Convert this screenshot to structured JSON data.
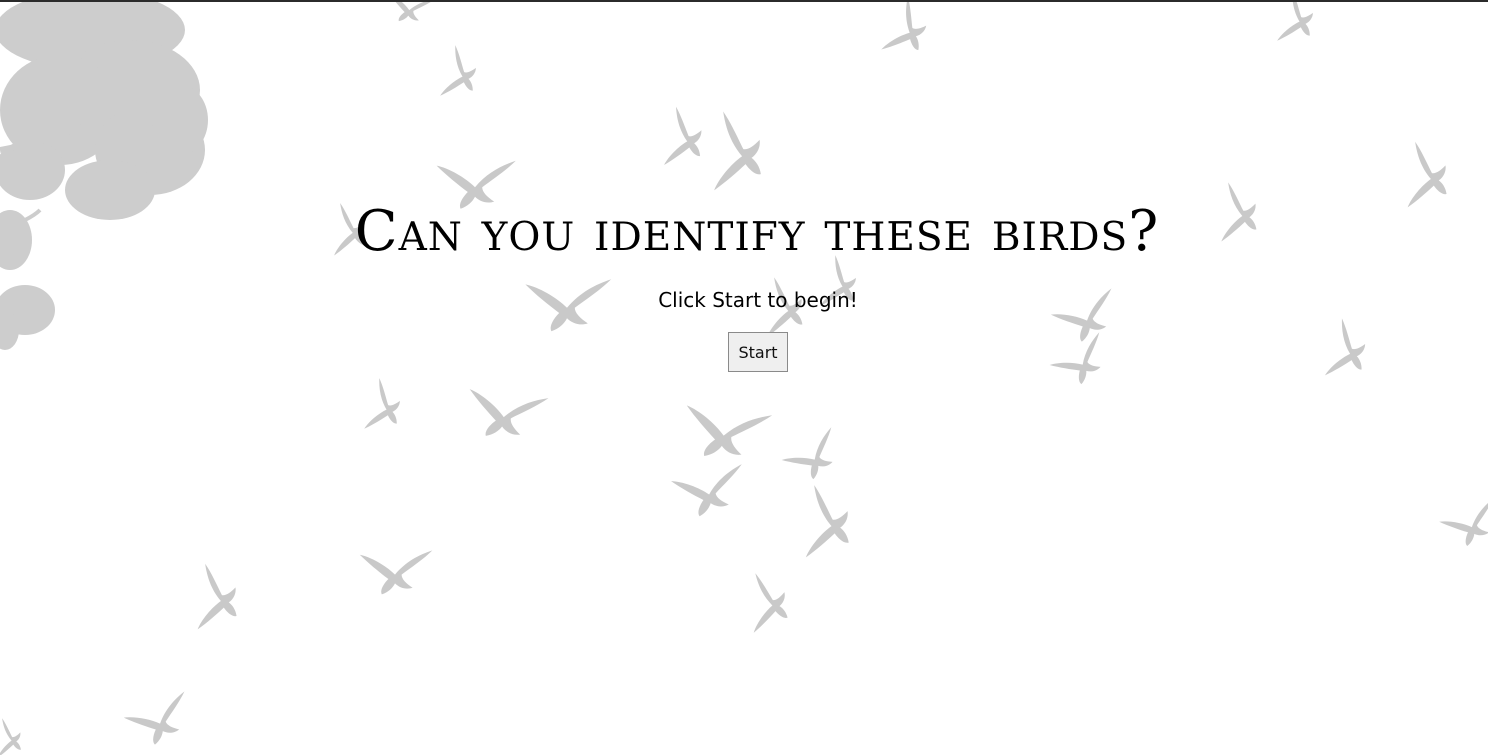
{
  "heading": "Can you identify these birds?",
  "instruction": "Click Start to begin!",
  "start_button": "Start",
  "colors": {
    "background": "#ffffff",
    "bird_silhouette": "#c9c9c9",
    "tree_silhouette": "#cdcdcd",
    "text": "#000000",
    "button_bg": "#efefef"
  },
  "background_icons": [
    "tree-branch-icon",
    "flying-bird-icon"
  ]
}
